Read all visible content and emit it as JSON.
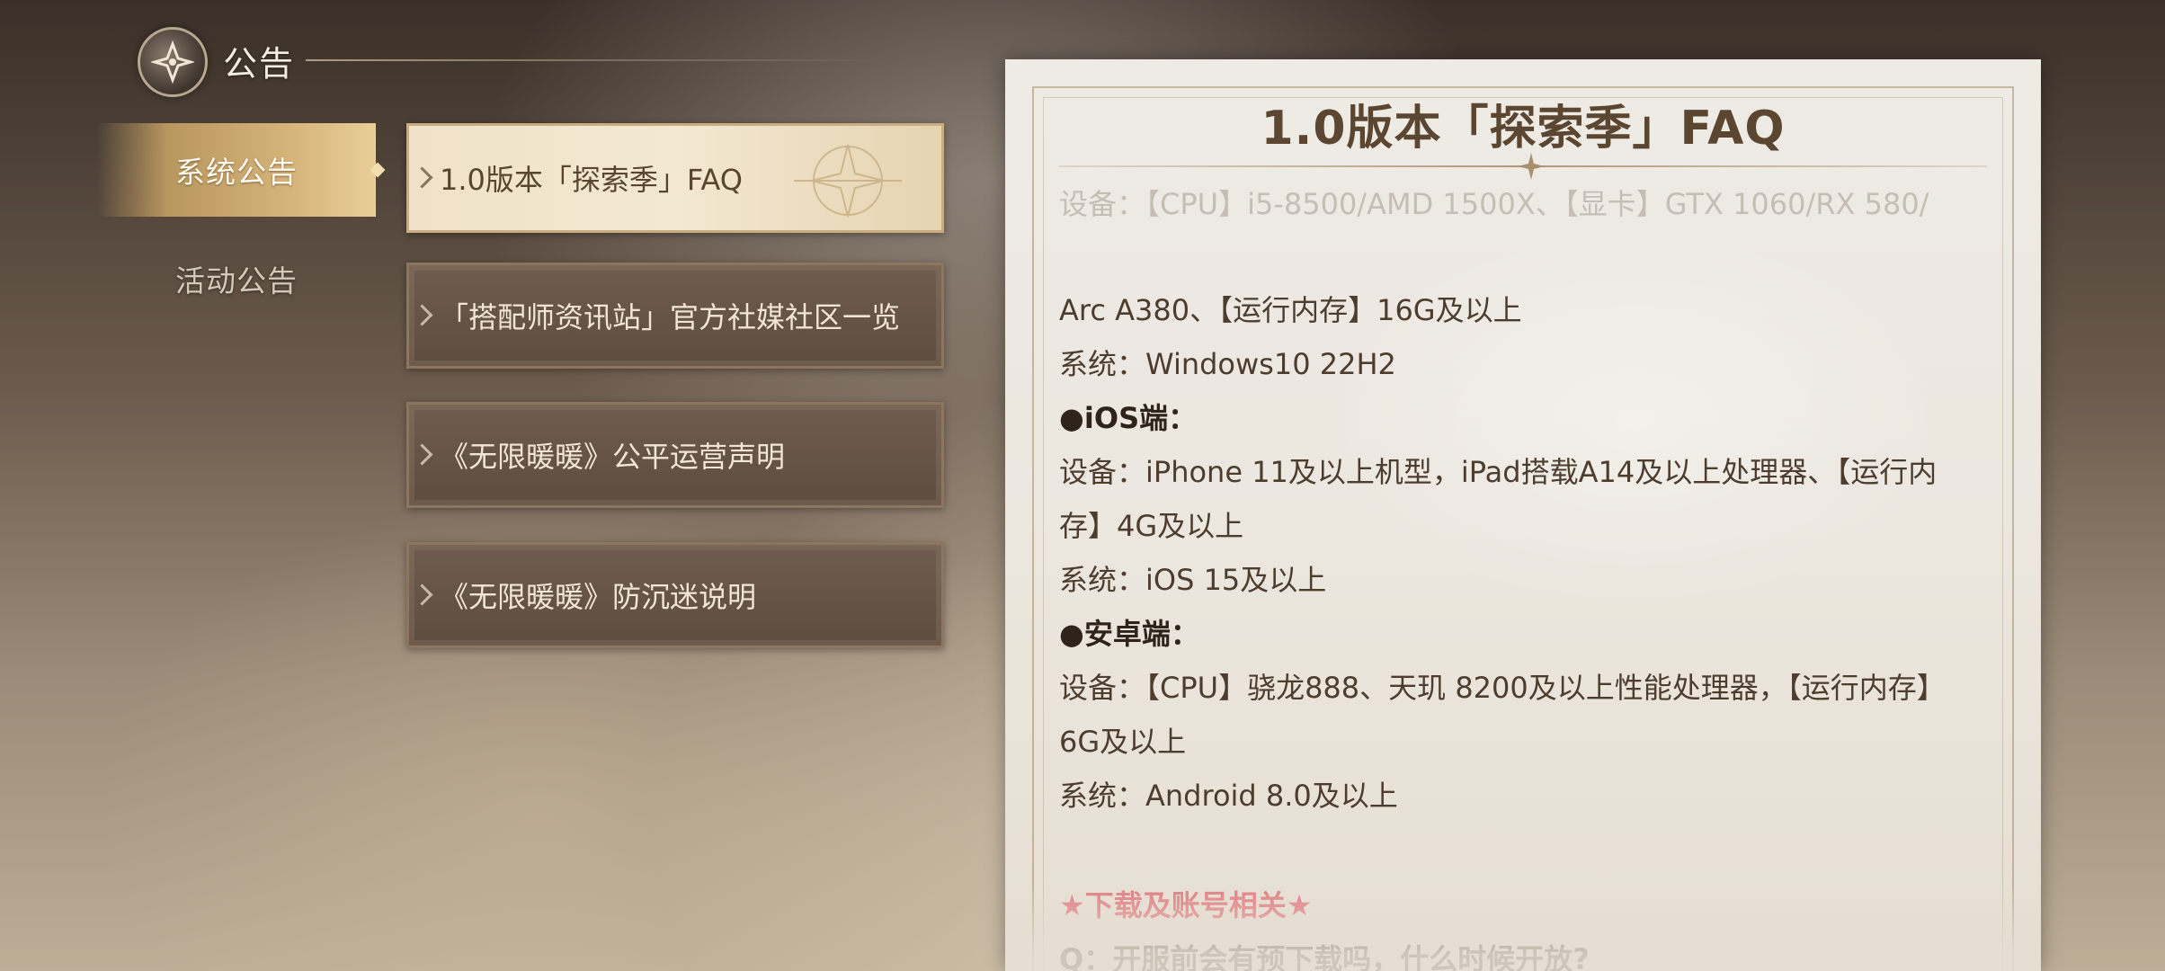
{
  "header": {
    "title": "公告",
    "logo_icon": "nikki-emblem-icon"
  },
  "categories": [
    {
      "label": "系统公告",
      "active": true
    },
    {
      "label": "活动公告",
      "active": false
    }
  ],
  "announcements": [
    {
      "title": "1.0版本「探索季」FAQ",
      "active": true
    },
    {
      "title": "「搭配师资讯站」官方社媒社区一览",
      "active": false
    },
    {
      "title": "《无限暖暖》公平运营声明",
      "active": false
    },
    {
      "title": "《无限暖暖》防沉迷说明",
      "active": false
    }
  ],
  "document": {
    "title": "1.0版本「探索季」FAQ",
    "lines": [
      {
        "text": "设备：【CPU】i5-8500/AMD 1500X、【显卡】GTX 1060/RX 580/",
        "style": "faded"
      },
      {
        "text": "Arc A380、【运行内存】16G及以上",
        "style": "body"
      },
      {
        "text": "系统：Windows10 22H2",
        "style": "body"
      },
      {
        "text": "●iOS端：",
        "style": "heading"
      },
      {
        "text": "设备：iPhone 11及以上机型，iPad搭载A14及以上处理器、【运行内",
        "style": "body"
      },
      {
        "text": "存】4G及以上",
        "style": "body"
      },
      {
        "text": "系统：iOS 15及以上",
        "style": "body"
      },
      {
        "text": "●安卓端：",
        "style": "heading"
      },
      {
        "text": "设备：【CPU】骁龙888、天玑 8200及以上性能处理器，【运行内存】",
        "style": "body"
      },
      {
        "text": "6G及以上",
        "style": "body"
      },
      {
        "text": "系统：Android 8.0及以上",
        "style": "body"
      },
      {
        "text": "",
        "style": "body"
      },
      {
        "text": "★下载及账号相关★",
        "style": "section"
      },
      {
        "text": "Q：开服前会有预下载吗，什么时候开放?",
        "style": "question"
      }
    ]
  },
  "colors": {
    "active_tab": "#d6b57b",
    "section_pink": "#e07a80",
    "panel_bg": "#ece7df"
  }
}
